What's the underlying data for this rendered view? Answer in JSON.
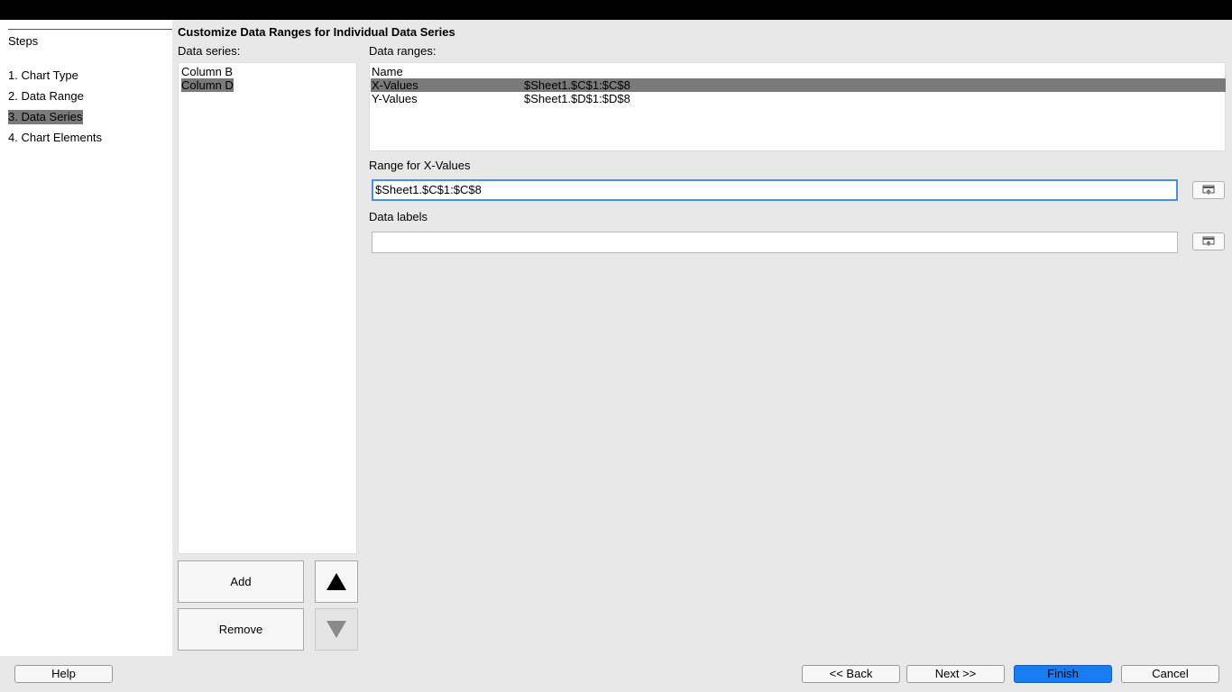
{
  "steps": {
    "title": "Steps",
    "items": [
      {
        "label": "1. Chart Type"
      },
      {
        "label": "2. Data Range"
      },
      {
        "label": "3. Data Series"
      },
      {
        "label": "4. Chart Elements"
      }
    ],
    "active_index": 2
  },
  "main": {
    "heading": "Customize Data Ranges for Individual Data Series",
    "data_series_label": "Data series:",
    "data_series": [
      "Column B",
      "Column D"
    ],
    "selected_series": "Column D",
    "data_ranges_label": "Data ranges:",
    "ranges_header": "Name",
    "ranges": [
      {
        "name": "X-Values",
        "range": "$Sheet1.$C$1:$C$8"
      },
      {
        "name": "Y-Values",
        "range": "$Sheet1.$D$1:$D$8"
      }
    ],
    "range_for_label": "Range for X-Values",
    "range_value": "$Sheet1.$C$1:$C$8",
    "data_labels_label": "Data labels",
    "data_labels_value": "",
    "add_label": "Add",
    "remove_label": "Remove"
  },
  "footer": {
    "help": "Help",
    "back": "<< Back",
    "next": "Next >>",
    "finish": "Finish",
    "cancel": "Cancel"
  },
  "icons": {
    "move_up": "triangle-up-icon",
    "move_down": "triangle-down-icon",
    "shrink": "shrink-dialog-icon"
  },
  "colors": {
    "selection": "#7a7a7a",
    "focus_border": "#4a90d9",
    "primary_button": "#1a7cf2"
  }
}
